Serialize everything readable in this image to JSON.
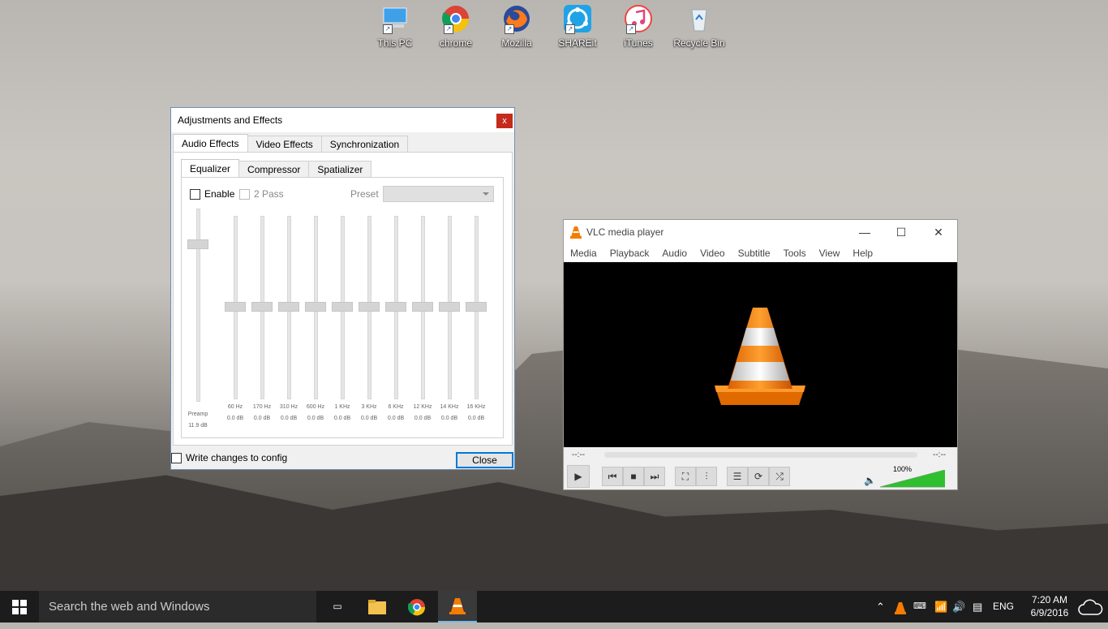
{
  "desktop": {
    "icons": [
      {
        "label": "This PC"
      },
      {
        "label": "chrome"
      },
      {
        "label": "Mozilla"
      },
      {
        "label": "SHAREit"
      },
      {
        "label": "iTunes"
      },
      {
        "label": "Recycle Bin"
      }
    ]
  },
  "adjustments": {
    "title": "Adjustments and Effects",
    "close_glyph": "x",
    "tabs": [
      "Audio Effects",
      "Video Effects",
      "Synchronization"
    ],
    "subtabs": [
      "Equalizer",
      "Compressor",
      "Spatializer"
    ],
    "enable_label": "Enable",
    "twopass_label": "2 Pass",
    "preset_label": "Preset",
    "preamp": {
      "label": "Preamp",
      "value": "11.9 dB",
      "level": 0.83
    },
    "bands": [
      {
        "freq": "60 Hz",
        "db": "0.0 dB"
      },
      {
        "freq": "170 Hz",
        "db": "0.0 dB"
      },
      {
        "freq": "310 Hz",
        "db": "0.0 dB"
      },
      {
        "freq": "600 Hz",
        "db": "0.0 dB"
      },
      {
        "freq": "1 KHz",
        "db": "0.0 dB"
      },
      {
        "freq": "3 KHz",
        "db": "0.0 dB"
      },
      {
        "freq": "6 KHz",
        "db": "0.0 dB"
      },
      {
        "freq": "12 KHz",
        "db": "0.0 dB"
      },
      {
        "freq": "14 KHz",
        "db": "0.0 dB"
      },
      {
        "freq": "16 KHz",
        "db": "0.0 dB"
      }
    ],
    "write_config_label": "Write changes to config",
    "close_button": "Close"
  },
  "vlc": {
    "title": "VLC media player",
    "menu": [
      "Media",
      "Playback",
      "Audio",
      "Video",
      "Subtitle",
      "Tools",
      "View",
      "Help"
    ],
    "time_elapsed": "--:--",
    "time_total": "--:--",
    "volume_label": "100%",
    "volume_level": 1.0
  },
  "taskbar": {
    "search_placeholder": "Search the web and Windows",
    "language": "ENG",
    "time": "7:20 AM",
    "date": "6/9/2016"
  },
  "colors": {
    "accent": "#0078d7",
    "close_red": "#c42b1c",
    "vlc_orange": "#f57c00",
    "volume_green": "#2fbf2f"
  }
}
